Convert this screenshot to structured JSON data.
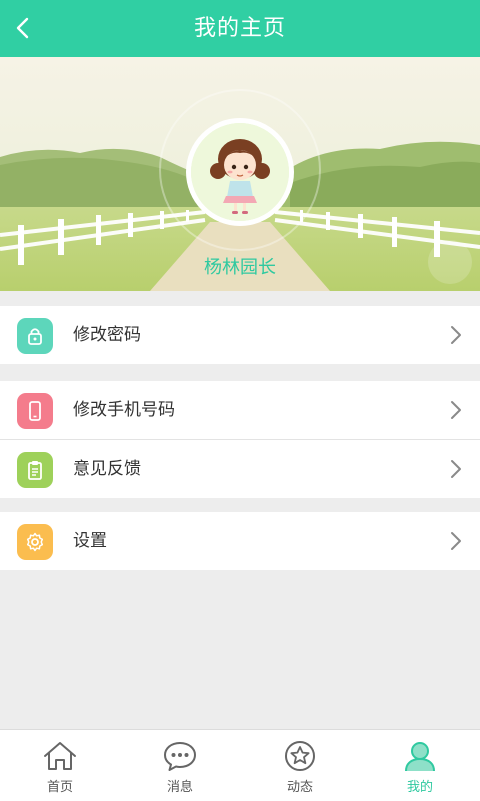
{
  "header": {
    "title": "我的主页",
    "back_icon": "chevron-left-icon"
  },
  "profile": {
    "name": "杨林园长",
    "avatar": "cartoon-girl-avatar"
  },
  "menu_groups": [
    [
      {
        "label": "修改密码",
        "icon": "lock-icon",
        "color": "#5dd6bb"
      }
    ],
    [
      {
        "label": "修改手机号码",
        "icon": "phone-icon",
        "color": "#f47c8c"
      },
      {
        "label": "意见反馈",
        "icon": "clipboard-icon",
        "color": "#9ed15a"
      }
    ],
    [
      {
        "label": "设置",
        "icon": "gear-icon",
        "color": "#fbbd4f"
      }
    ]
  ],
  "tabs": [
    {
      "label": "首页",
      "icon": "home-icon",
      "active": false
    },
    {
      "label": "消息",
      "icon": "chat-icon",
      "active": false
    },
    {
      "label": "动态",
      "icon": "star-icon",
      "active": false
    },
    {
      "label": "我的",
      "icon": "user-icon",
      "active": true
    }
  ],
  "colors": {
    "accent": "#30cfa3",
    "background": "#ededed"
  }
}
